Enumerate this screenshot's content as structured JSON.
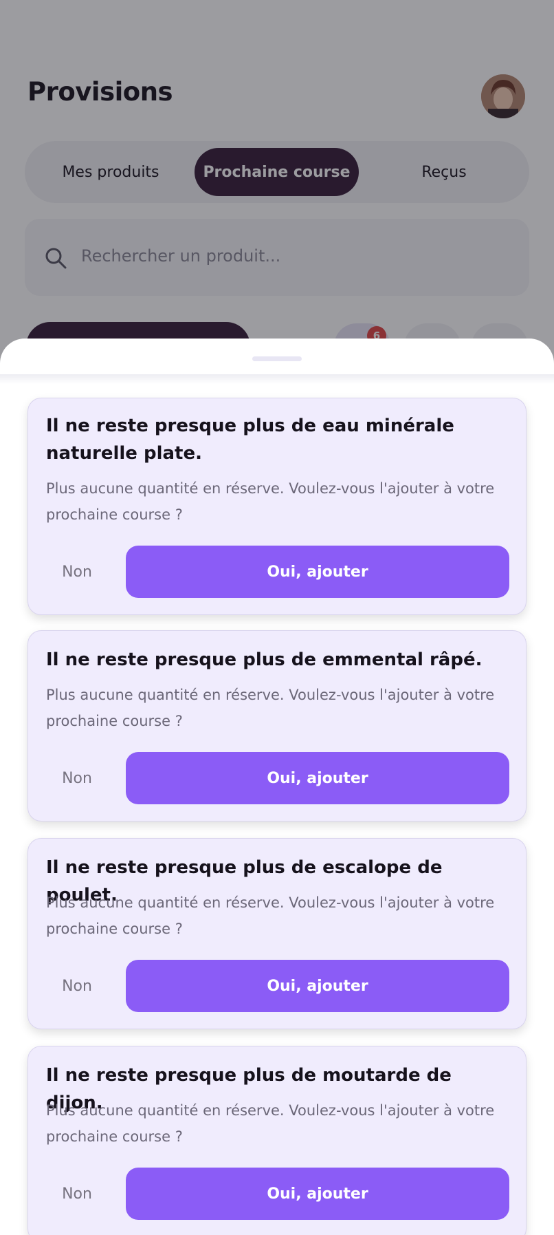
{
  "header": {
    "title": "Provisions"
  },
  "tabs": [
    {
      "label": "Mes produits"
    },
    {
      "label": "Prochaine course"
    },
    {
      "label": "Reçus"
    }
  ],
  "search": {
    "placeholder": "Rechercher un produit..."
  },
  "filter": {
    "badge_count": "6"
  },
  "alerts": [
    {
      "title": "Il ne reste presque plus de eau minérale naturelle plate.",
      "message": "Plus aucune quantité en réserve. Voulez-vous l'ajouter à votre prochaine course ?",
      "no_label": "Non",
      "yes_label": "Oui, ajouter"
    },
    {
      "title": "Il ne reste presque plus de emmental râpé.",
      "message": "Plus aucune quantité en réserve. Voulez-vous l'ajouter à votre prochaine course ?",
      "no_label": "Non",
      "yes_label": "Oui, ajouter"
    },
    {
      "title": "Il ne reste presque plus de escalope de poulet.",
      "message": "Plus aucune quantité en réserve. Voulez-vous l'ajouter à votre prochaine course ?",
      "no_label": "Non",
      "yes_label": "Oui, ajouter"
    },
    {
      "title": "Il ne reste presque plus de moutarde de dijon.",
      "message": "Plus aucune quantité en réserve. Voulez-vous l'ajouter à votre prochaine course ?",
      "no_label": "Non",
      "yes_label": "Oui, ajouter"
    }
  ],
  "colors": {
    "accent": "#8b5cf6",
    "dark": "#3a1f3c",
    "card_bg": "#f0ecfd",
    "badge": "#e04848"
  }
}
